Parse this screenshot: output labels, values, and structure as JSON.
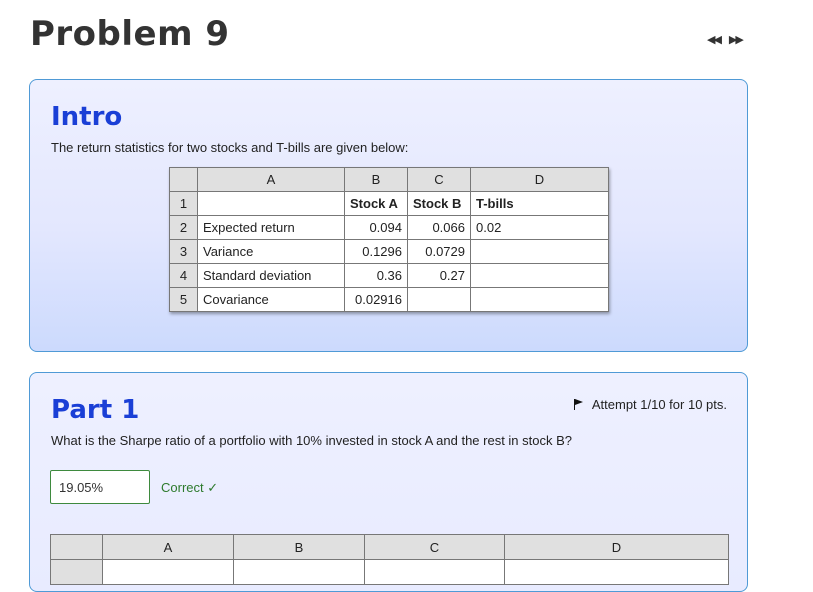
{
  "page": {
    "title": "Problem 9"
  },
  "nav": {
    "prev": "◀◀",
    "next": "▶▶"
  },
  "intro": {
    "heading": "Intro",
    "text": "The return statistics for two stocks and T-bills are given below:",
    "sheet": {
      "columns": [
        "A",
        "B",
        "C",
        "D"
      ],
      "rows": [
        {
          "n": "1",
          "a": "",
          "b": "Stock A",
          "c": "Stock B",
          "d": "T-bills"
        },
        {
          "n": "2",
          "a": "Expected return",
          "b": "0.094",
          "c": "0.066",
          "d": "0.02"
        },
        {
          "n": "3",
          "a": "Variance",
          "b": "0.1296",
          "c": "0.0729",
          "d": ""
        },
        {
          "n": "4",
          "a": "Standard deviation",
          "b": "0.36",
          "c": "0.27",
          "d": ""
        },
        {
          "n": "5",
          "a": "Covariance",
          "b": "0.02916",
          "c": "",
          "d": ""
        }
      ]
    }
  },
  "part1": {
    "heading": "Part 1",
    "attempt": "Attempt 1/10 for 10 pts.",
    "question": "What is the Sharpe ratio of a portfolio with 10% invested in stock A and the rest in stock B?",
    "answer_value": "19.05%",
    "status": "Correct ✓",
    "sheet": {
      "columns": [
        "A",
        "B",
        "C",
        "D"
      ]
    }
  }
}
